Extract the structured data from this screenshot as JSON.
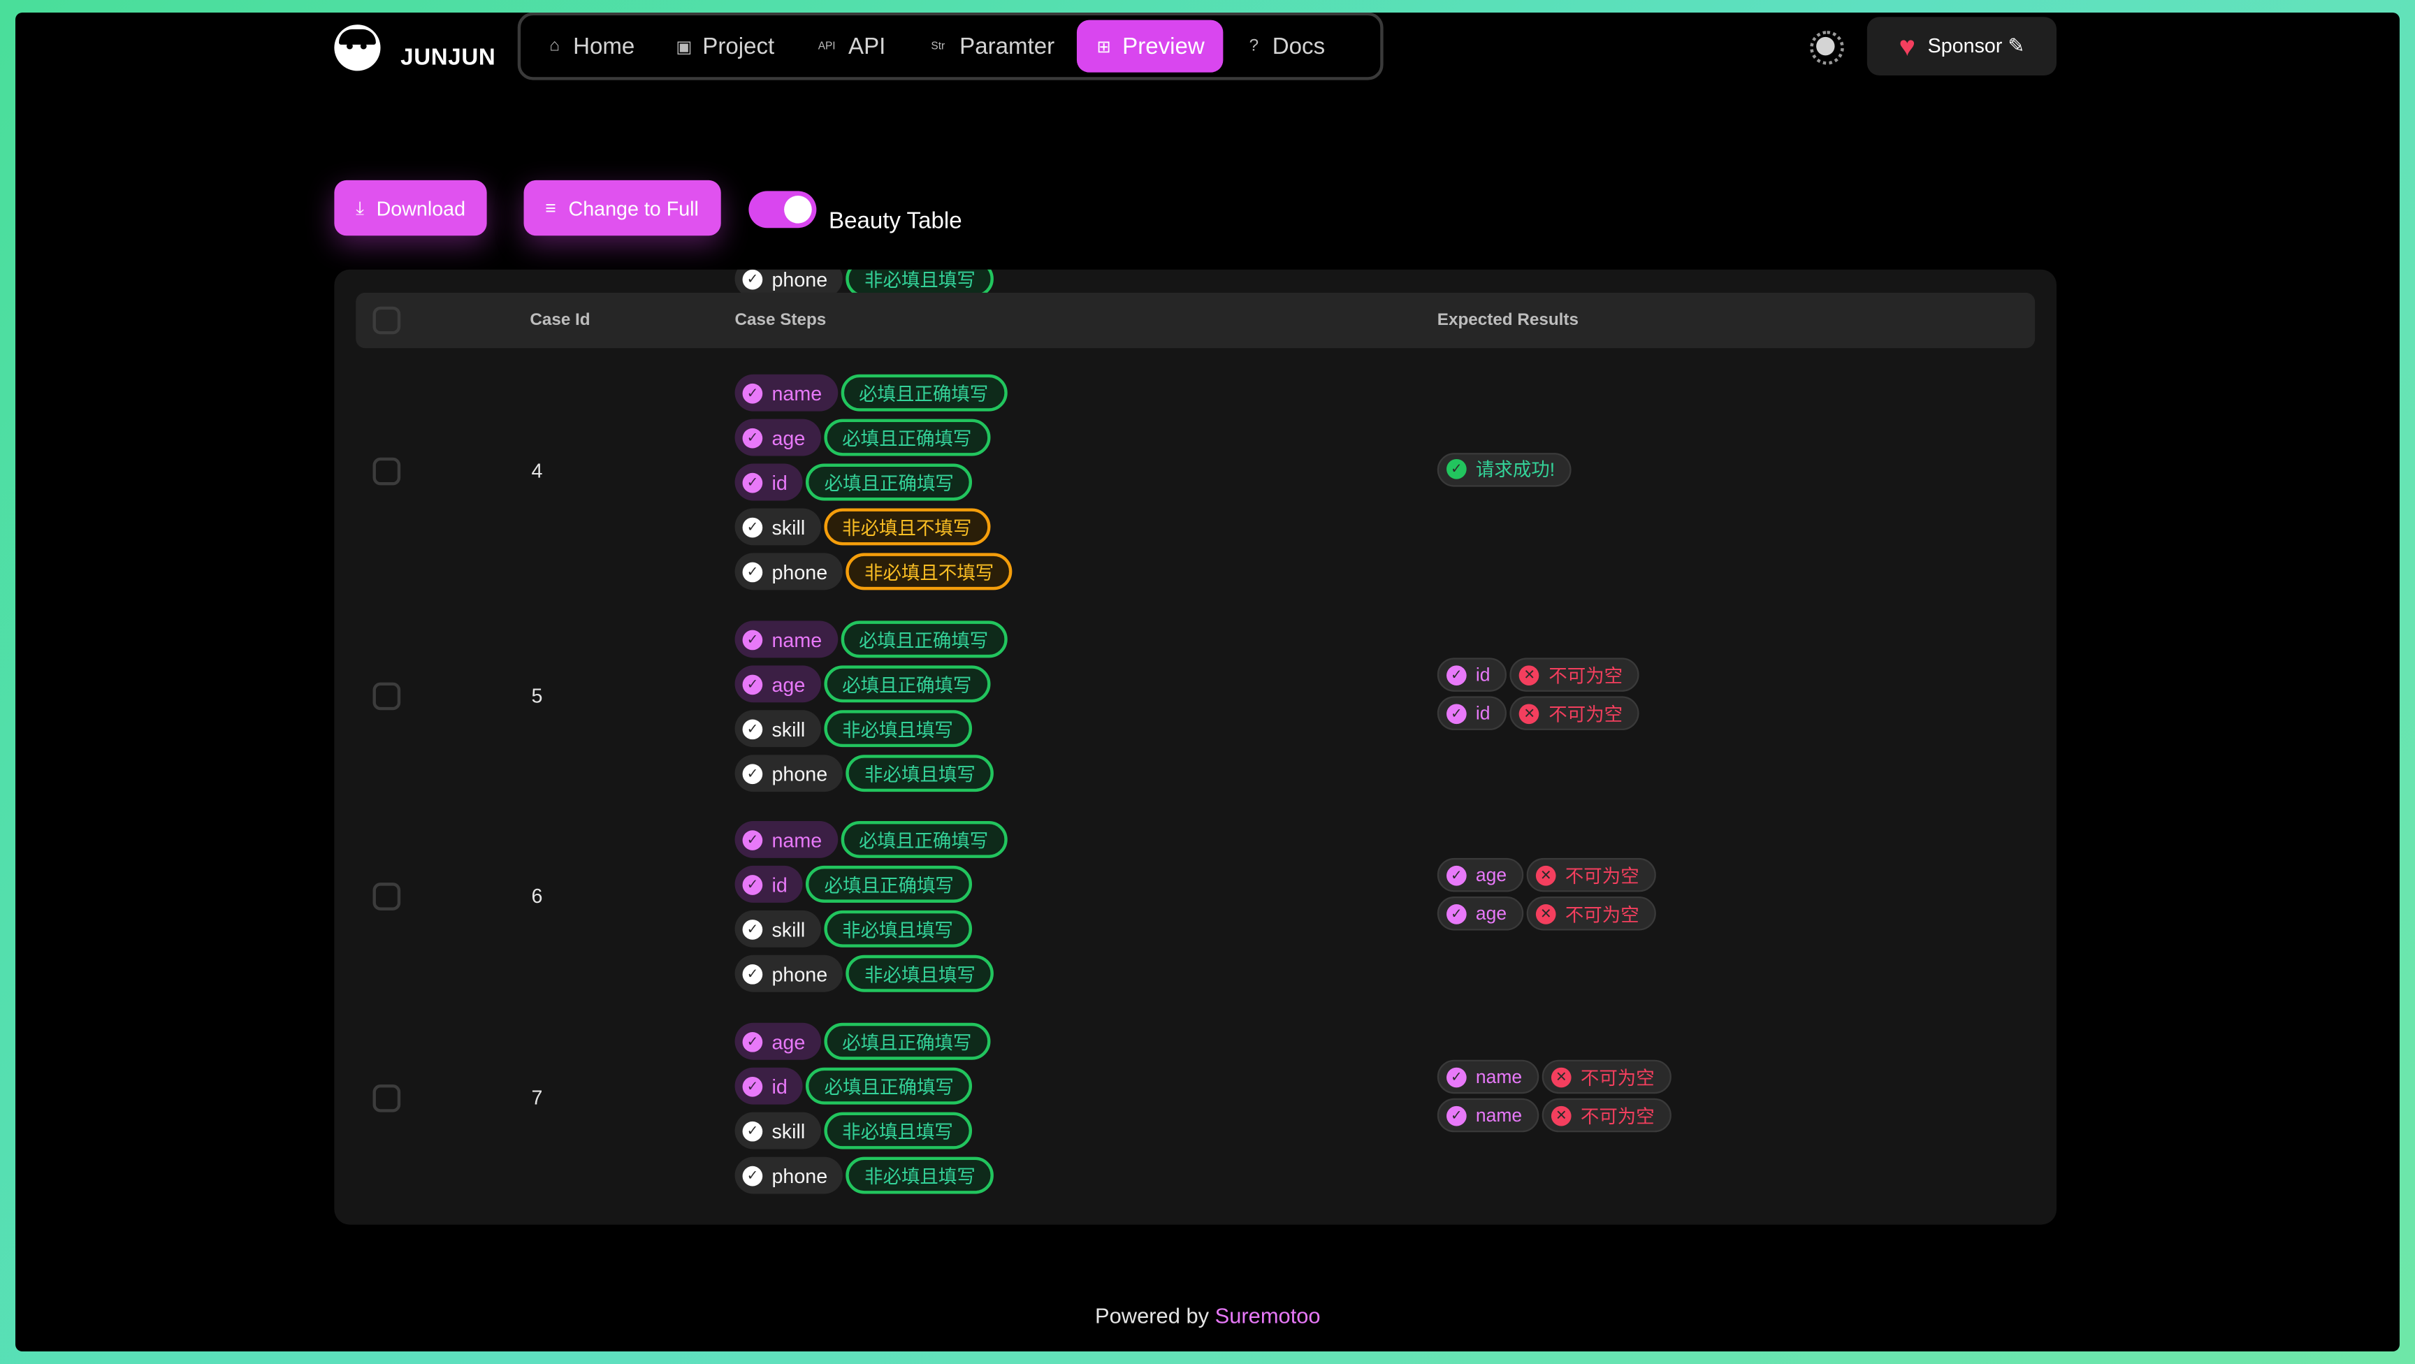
{
  "header": {
    "brand": "JUNJUN",
    "nav": [
      {
        "label": "Home",
        "icon": "⌂",
        "active": false
      },
      {
        "label": "Project",
        "icon": "▣",
        "active": false
      },
      {
        "label": "API",
        "icon": "API",
        "active": false
      },
      {
        "label": "Paramter",
        "icon": "Str",
        "active": false
      },
      {
        "label": "Preview",
        "icon": "⊞",
        "active": true
      },
      {
        "label": "Docs",
        "icon": "?",
        "active": false
      }
    ],
    "sponsor_label": "Sponsor ✎"
  },
  "toolbar": {
    "download_label": "Download",
    "change_label": "Change to Full",
    "beauty_label": "Beauty Table",
    "beauty_on": true
  },
  "table": {
    "columns": [
      "Case Id",
      "Case Steps",
      "Expected Results"
    ],
    "partial_top": {
      "field": "phone",
      "tag": "非必填且填写"
    },
    "rows": [
      {
        "id": "4",
        "steps": [
          {
            "field": "name",
            "required": true,
            "tag": "必填且正确填写",
            "tone": "green"
          },
          {
            "field": "age",
            "required": true,
            "tag": "必填且正确填写",
            "tone": "green"
          },
          {
            "field": "id",
            "required": true,
            "tag": "必填且正确填写",
            "tone": "green"
          },
          {
            "field": "skill",
            "required": false,
            "tag": "非必填且不填写",
            "tone": "orange"
          },
          {
            "field": "phone",
            "required": false,
            "tag": "非必填且不填写",
            "tone": "orange"
          }
        ],
        "results": [
          [
            {
              "text": "请求成功!",
              "kind": "ok"
            }
          ]
        ]
      },
      {
        "id": "5",
        "steps": [
          {
            "field": "name",
            "required": true,
            "tag": "必填且正确填写",
            "tone": "green"
          },
          {
            "field": "age",
            "required": true,
            "tag": "必填且正确填写",
            "tone": "green"
          },
          {
            "field": "skill",
            "required": false,
            "tag": "非必填且填写",
            "tone": "green"
          },
          {
            "field": "phone",
            "required": false,
            "tag": "非必填且填写",
            "tone": "green"
          }
        ],
        "results": [
          [
            {
              "text": "id",
              "kind": "field"
            },
            {
              "text": "不可为空",
              "kind": "err"
            }
          ],
          [
            {
              "text": "id",
              "kind": "field"
            },
            {
              "text": "不可为空",
              "kind": "err"
            }
          ]
        ]
      },
      {
        "id": "6",
        "steps": [
          {
            "field": "name",
            "required": true,
            "tag": "必填且正确填写",
            "tone": "green"
          },
          {
            "field": "id",
            "required": true,
            "tag": "必填且正确填写",
            "tone": "green"
          },
          {
            "field": "skill",
            "required": false,
            "tag": "非必填且填写",
            "tone": "green"
          },
          {
            "field": "phone",
            "required": false,
            "tag": "非必填且填写",
            "tone": "green"
          }
        ],
        "results": [
          [
            {
              "text": "age",
              "kind": "field"
            },
            {
              "text": "不可为空",
              "kind": "err"
            }
          ],
          [
            {
              "text": "age",
              "kind": "field"
            },
            {
              "text": "不可为空",
              "kind": "err"
            }
          ]
        ]
      },
      {
        "id": "7",
        "steps": [
          {
            "field": "age",
            "required": true,
            "tag": "必填且正确填写",
            "tone": "green"
          },
          {
            "field": "id",
            "required": true,
            "tag": "必填且正确填写",
            "tone": "green"
          },
          {
            "field": "skill",
            "required": false,
            "tag": "非必填且填写",
            "tone": "green"
          },
          {
            "field": "phone",
            "required": false,
            "tag": "非必填且填写",
            "tone": "green"
          }
        ],
        "results": [
          [
            {
              "text": "name",
              "kind": "field"
            },
            {
              "text": "不可为空",
              "kind": "err"
            }
          ],
          [
            {
              "text": "name",
              "kind": "field"
            },
            {
              "text": "不可为空",
              "kind": "err"
            }
          ]
        ]
      }
    ]
  },
  "footer": {
    "prefix": "Powered by ",
    "link": "Suremotoo"
  }
}
